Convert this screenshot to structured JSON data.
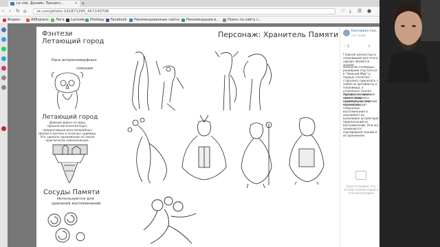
{
  "browser": {
    "tab_title": "Le vlat. Дизайн: Процесс...",
    "address": "vk.com/photo-191871295_457240706",
    "bookmarks": [
      "Яндекс",
      "AliExpress",
      "Лига",
      "Lamoda",
      "Pixelbay",
      "Facebook",
      "Рекомендованные сайты",
      "Рекомендации в...",
      "Поиск по сайту с..."
    ],
    "bookmark_colors": [
      "#d33",
      "#e8571e",
      "#6b4",
      "#333",
      "#3a7",
      "#3b5998",
      "#4a76a8",
      "#2a9d8f",
      "#888"
    ]
  },
  "artwork": {
    "main_title": "Персонаж: Хранитель Памяти",
    "genre_title": "Фэнтези",
    "city_title": "Летающий город",
    "race_label": "Раса антропоморфных",
    "owl_label": "совушек",
    "city_subtitle": "Летающий город",
    "city_lines": [
      "Давным-давно по миру",
      "прошла магическая буря,",
      "превратившая всех волшебных",
      "зверей в жутких и опасных чудовищ.",
      "Это сделало проживание на земле",
      "практически невозможным."
    ],
    "vessels_title": "Сосуды Памяти",
    "vessels_lines": [
      "Используются для",
      "хранения воспоминаний"
    ]
  },
  "post": {
    "author": "Екатерина Смо...",
    "date": "час назад",
    "paragraph1": "Главной ценностью и сокровищем для этого народа являются знания.",
    "paragraph2": "Немногие очевидцы, решившие спуститься в \"Нижний Мир\" в первые столетия - старались приносить с собой не артефакты и сокровища, а утерянные знания народов, которые не посчастливилось пережить магический катаклизм.",
    "paragraph3": "Хранители памяти самого рода архивариусы, они просматривают собранные воспоминания и оценивают их, выпиливая ассиметрии приключений из воспоминаний. Они же занимаются сортировкой знаний и их хранением.",
    "likes": "1",
    "no_comments": "Будьте первым, кто оставит комментарий к этой фотографии"
  }
}
